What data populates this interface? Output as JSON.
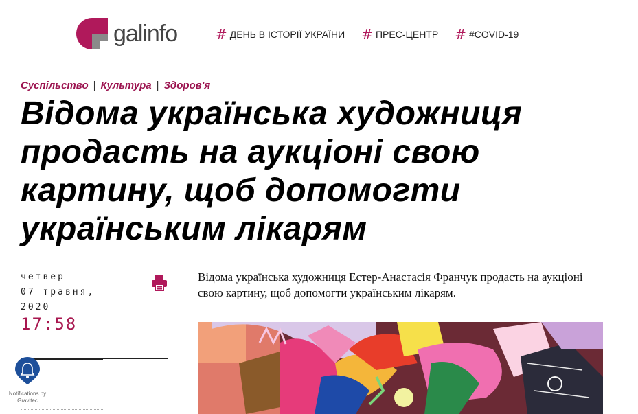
{
  "header": {
    "logo_text": "galinfo",
    "nav": [
      {
        "hash": "#",
        "label": "ДЕНЬ В ІСТОРІЇ УКРАЇНИ"
      },
      {
        "hash": "#",
        "label": "ПРЕС-ЦЕНТР"
      },
      {
        "hash": "#",
        "label": "#COVID-19"
      }
    ]
  },
  "categories": [
    "Суспільство",
    "Культура",
    "Здоров'я"
  ],
  "separators": [
    "|",
    "|"
  ],
  "title": "Відома українська художниця продасть на аукціоні свою картину, щоб допомогти українським лікарям",
  "date": {
    "weekday": "четвер",
    "day_month": "07 травня,",
    "year": "2020",
    "time": "17:58"
  },
  "lead": "Відома українська художниця Естер-Анастасія Франчук продасть на аукціоні свою картину, щоб допомогти українським лікарям.",
  "notification": {
    "text": "Notifications by Gravitec"
  },
  "colors": {
    "accent": "#b0195b",
    "time": "#a8174f"
  }
}
